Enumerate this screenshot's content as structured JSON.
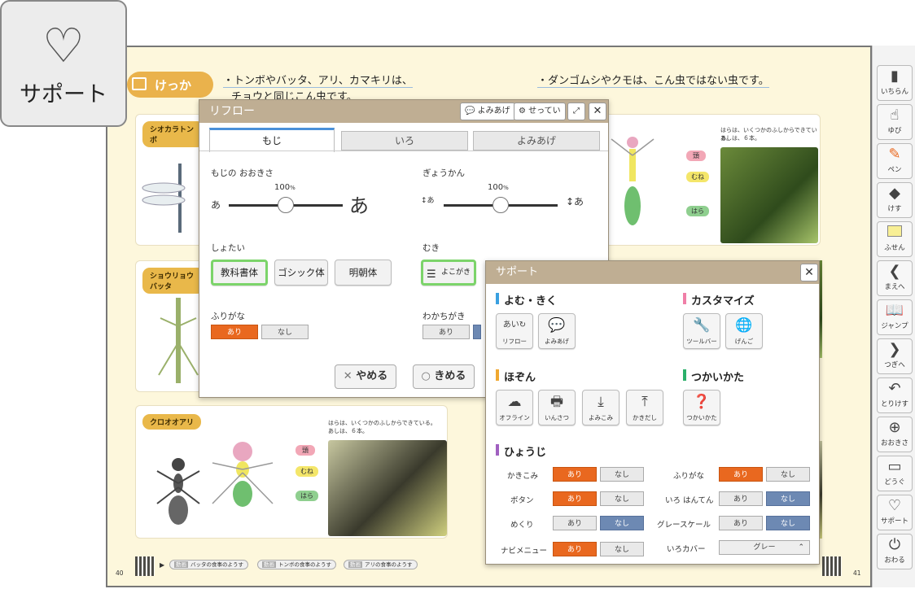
{
  "sapo_button": {
    "label": "サポート",
    "icon": "heart-icon"
  },
  "page": {
    "kekka_label": "けっか",
    "line1": "・トンボやバッタ、アリ、カマキリは、",
    "line2": "チョウと同じこん虫です。",
    "line3": "・ダンゴムシやクモは、こん虫ではない虫です。",
    "cards": [
      {
        "tag": "シオカラトンボ"
      },
      {
        "tag": "ショウリョウバッタ"
      },
      {
        "tag": "クロオオアリ",
        "note1": "はらは、いくつかのふしからできている。",
        "note2": "あしは、６本。",
        "labels": [
          "頭",
          "むね",
          "はら"
        ]
      }
    ],
    "right_card": {
      "note1": "はらは、いくつかのふしからできている。",
      "note2": "あしは、６本。",
      "labels": [
        "頭",
        "むね",
        "はら"
      ]
    },
    "page_left": "40",
    "page_right": "41",
    "videos": [
      {
        "tag": "動画",
        "label": "バッタの食事のようす"
      },
      {
        "tag": "動画",
        "label": "トンボの食事のようす"
      },
      {
        "tag": "動画",
        "label": "アリの食事のようす"
      }
    ]
  },
  "reflow": {
    "title": "リフロー",
    "yomiage": "よみあげ",
    "settei": "せってい",
    "tabs": [
      "もじ",
      "いろ",
      "よみあげ"
    ],
    "font_size_label": "もじの おおきさ",
    "font_size_value": "100",
    "font_size_unit": "%",
    "line_gap_label": "ぎょうかん",
    "line_gap_value": "100",
    "line_gap_unit": "%",
    "small_a": "あ",
    "big_a": "あ",
    "typeface_label": "しょたい",
    "typefaces": [
      "教科書体",
      "ゴシック体",
      "明朝体"
    ],
    "direction_label": "むき",
    "direction_value": "よこがき",
    "furigana_label": "ふりがな",
    "wakachi_label": "わかちがき",
    "ari": "あり",
    "nashi": "なし",
    "cancel": "やめる",
    "ok": "きめる"
  },
  "support": {
    "title": "サポート",
    "sec_read": "よむ・きく",
    "sec_custom": "カスタマイズ",
    "sec_save": "ほぞん",
    "sec_howto": "つかいかた",
    "sec_display": "ひょうじ",
    "btn_reflow": "リフロー",
    "btn_yomiage": "よみあげ",
    "btn_toolbar": "ツールバー",
    "btn_gengo": "げんご",
    "btn_offline": "オフライン",
    "btn_print": "いんさつ",
    "btn_import": "よみこみ",
    "btn_export": "かきだし",
    "btn_howto": "つかいかた",
    "rows_left": [
      "かきこみ",
      "ボタン",
      "めくり",
      "ナビメニュー"
    ],
    "rows_right": [
      "ふりがな",
      "いろ はんてん",
      "グレースケール",
      "いろカバー"
    ],
    "ari": "あり",
    "nashi": "なし",
    "iro_cover_value": "グレー"
  },
  "rightbar": [
    {
      "label": "いちらん",
      "icon": "list-icon"
    },
    {
      "label": "ゆび",
      "icon": "finger-icon"
    },
    {
      "label": "ペン",
      "icon": "pen-icon"
    },
    {
      "label": "けす",
      "icon": "eraser-icon"
    },
    {
      "label": "ふせん",
      "icon": "sticky-note-icon"
    },
    {
      "label": "まえへ",
      "icon": "prev-icon"
    },
    {
      "label": "ジャンプ",
      "icon": "jump-icon"
    },
    {
      "label": "つぎへ",
      "icon": "next-icon"
    },
    {
      "label": "とりけす",
      "icon": "undo-icon"
    },
    {
      "label": "おおきさ",
      "icon": "zoom-icon"
    },
    {
      "label": "どうぐ",
      "icon": "tools-icon"
    },
    {
      "label": "サポート",
      "icon": "heart-icon"
    },
    {
      "label": "おわる",
      "icon": "power-icon"
    }
  ],
  "colors": {
    "accent_orange": "#e9681f",
    "header_tan": "#bfae93",
    "select_green": "#7cd46a",
    "blue_toggle": "#6d89b3"
  }
}
